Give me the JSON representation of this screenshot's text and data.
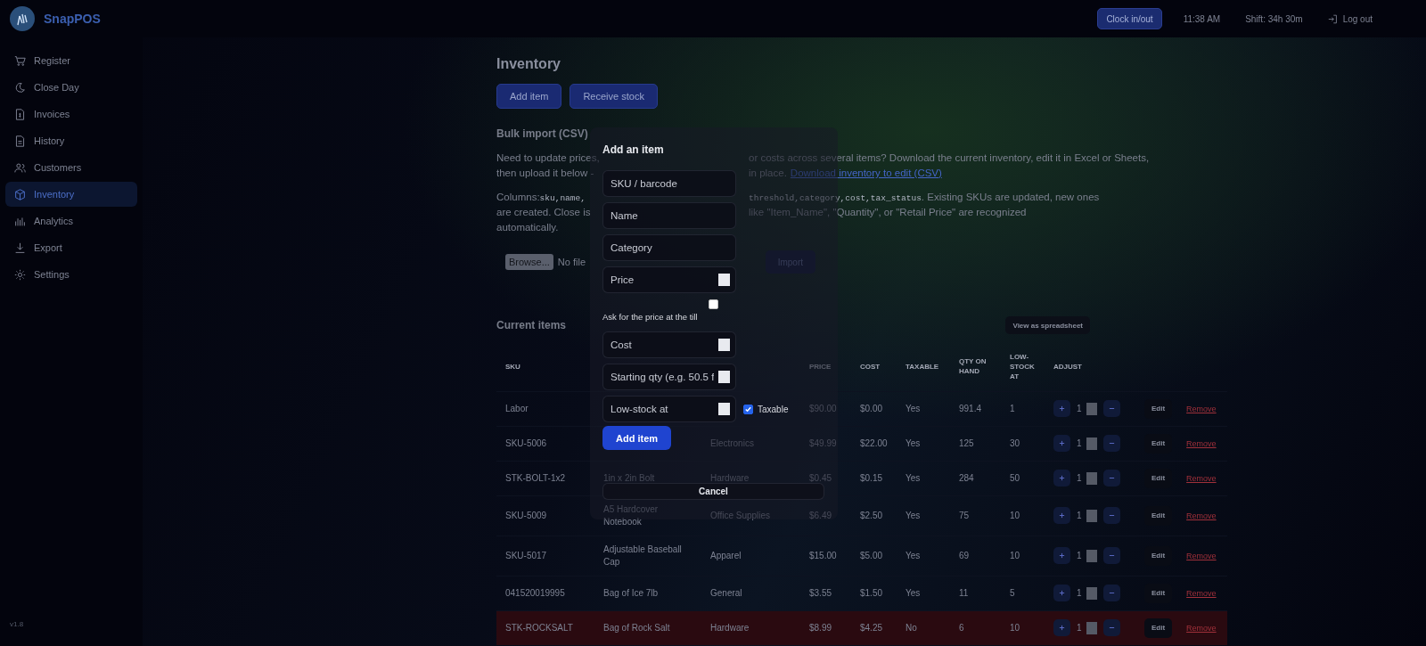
{
  "brand": {
    "name": "SnapPOS",
    "version": "v1.8"
  },
  "sidebar": {
    "items": [
      {
        "label": "Register",
        "selected": false
      },
      {
        "label": "Close Day",
        "selected": false
      },
      {
        "label": "Invoices",
        "selected": false
      },
      {
        "label": "History",
        "selected": false
      },
      {
        "label": "Customers",
        "selected": false
      },
      {
        "label": "Inventory",
        "selected": true
      },
      {
        "label": "Analytics",
        "selected": false
      },
      {
        "label": "Export",
        "selected": false
      },
      {
        "label": "Settings",
        "selected": false
      }
    ]
  },
  "topbar": {
    "clock_button": "Clock in/out",
    "time": "11:38 AM",
    "shift": "Shift: 34h 30m",
    "logout": "Log out"
  },
  "page": {
    "title": "Inventory",
    "buttons": [
      "Add item",
      "Receive stock"
    ]
  },
  "bulk_import": {
    "heading": "Bulk import (CSV)",
    "intro_lines": [
      {
        "left": "Need to update prices,",
        "right": "or costs across several items? Download the current inventory, edit it in Excel or Sheets,"
      },
      {
        "left": "then upload it below -",
        "right": "in place.",
        "link": "Download inventory to edit (CSV)"
      }
    ],
    "columns_lines": [
      {
        "left": "Columns:",
        "left_code": "sku,name,",
        "right_code": "threshold,category,cost,tax_status",
        "right": ". Existing SKUs are updated, new ones"
      },
      {
        "left": "are created. Close is",
        "right": "like \"Item_Name\", \"Quantity\", or \"Retail Price\" are recognized"
      },
      {
        "left": "automatically."
      }
    ],
    "browse": "Browse...",
    "file_status": "No file",
    "import_button": "Import"
  },
  "items": {
    "heading": "Current items",
    "spreadsheet_button": "View as spreadsheet",
    "columns": [
      "SKU",
      null,
      null,
      "PRICE",
      "COST",
      "TAXABLE",
      "QTY ON HAND",
      "LOW-STOCK AT",
      "ADJUST"
    ],
    "rows": [
      {
        "sku": "Labor",
        "price": "$90.00",
        "cost": "$0.00",
        "taxable": "Yes",
        "qty": "991.4",
        "low": "1",
        "adjust": "1",
        "edit": "Edit",
        "remove": "Remove",
        "low_stock": false
      },
      {
        "sku": "SKU-5006",
        "category": "Electronics",
        "price": "$49.99",
        "cost": "$22.00",
        "taxable": "Yes",
        "qty": "125",
        "low": "30",
        "adjust": "1",
        "edit": "Edit",
        "remove": "Remove",
        "low_stock": false
      },
      {
        "sku": "STK-BOLT-1x2",
        "name": "1in x 2in Bolt",
        "category": "Hardware",
        "price": "$0.45",
        "cost": "$0.15",
        "taxable": "Yes",
        "qty": "284",
        "low": "50",
        "adjust": "1",
        "edit": "Edit",
        "remove": "Remove",
        "low_stock": false
      },
      {
        "sku": "SKU-5009",
        "name": "A5 Hardcover Notebook",
        "category": "Office Supplies",
        "price": "$6.49",
        "cost": "$2.50",
        "taxable": "Yes",
        "qty": "75",
        "low": "10",
        "adjust": "1",
        "edit": "Edit",
        "remove": "Remove",
        "low_stock": false
      },
      {
        "sku": "SKU-5017",
        "name": "Adjustable Baseball Cap",
        "category": "Apparel",
        "price": "$15.00",
        "cost": "$5.00",
        "taxable": "Yes",
        "qty": "69",
        "low": "10",
        "adjust": "1",
        "edit": "Edit",
        "remove": "Remove",
        "low_stock": false
      },
      {
        "sku": "041520019995",
        "name": "Bag of Ice 7lb",
        "category": "General",
        "price": "$3.55",
        "cost": "$1.50",
        "taxable": "Yes",
        "qty": "11",
        "low": "5",
        "adjust": "1",
        "edit": "Edit",
        "remove": "Remove",
        "low_stock": false
      },
      {
        "sku": "STK-ROCKSALT",
        "name": "Bag of Rock Salt",
        "category": "Hardware",
        "price": "$8.99",
        "cost": "$4.25",
        "taxable": "No",
        "qty": "6",
        "low": "10",
        "adjust": "1",
        "edit": "Edit",
        "remove": "Remove",
        "low_stock": true
      }
    ]
  },
  "dialog": {
    "title": "Add an item",
    "fields": [
      {
        "kind": "text",
        "placeholder": "SKU / barcode"
      },
      {
        "kind": "text",
        "placeholder": "Name"
      },
      {
        "kind": "text",
        "placeholder": "Category"
      },
      {
        "kind": "number",
        "placeholder": "Price"
      },
      {
        "kind": "checkbox",
        "label": "Ask for the price at the till",
        "checked": false
      },
      {
        "kind": "number",
        "placeholder": "Cost"
      },
      {
        "kind": "number",
        "placeholder": "Starting qty (e.g. 50.5 f"
      },
      {
        "kind": "number",
        "placeholder": "Low-stock at",
        "checkbox_label": "Taxable",
        "checked": true
      }
    ],
    "submit": "Add item",
    "cancel": "Cancel"
  }
}
